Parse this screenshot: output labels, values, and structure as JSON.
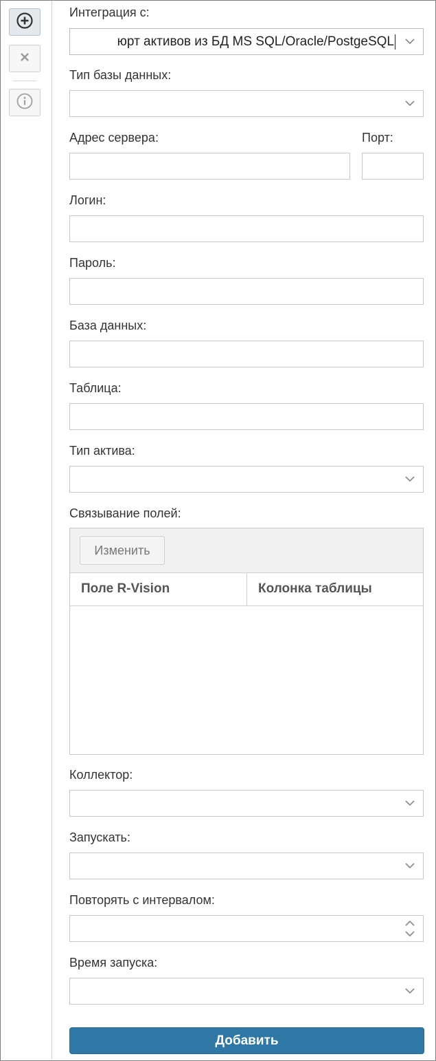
{
  "toolbar": {
    "add_icon": "plus-circle-icon",
    "delete_icon": "close-icon",
    "info_icon": "info-icon"
  },
  "form": {
    "integration_label": "Интеграция с:",
    "integration_value": "юрт активов из БД MS SQL/Oracle/PostgeSQL",
    "db_type_label": "Тип базы данных:",
    "db_type_value": "",
    "server_label": "Адрес сервера:",
    "server_value": "",
    "port_label": "Порт:",
    "port_value": "",
    "login_label": "Логин:",
    "login_value": "",
    "password_label": "Пароль:",
    "password_value": "",
    "database_label": "База данных:",
    "database_value": "",
    "table_label": "Таблица:",
    "table_value": "",
    "asset_type_label": "Тип актива:",
    "asset_type_value": "",
    "mapping_label": "Связывание полей:",
    "mapping": {
      "edit_button": "Изменить",
      "columns": [
        "Поле R-Vision",
        "Колонка таблицы"
      ],
      "rows": []
    },
    "collector_label": "Коллектор:",
    "collector_value": "",
    "run_label": "Запускать:",
    "run_value": "",
    "interval_label": "Повторять с интервалом:",
    "interval_value": "",
    "start_time_label": "Время запуска:",
    "start_time_value": "",
    "submit_label": "Добавить"
  },
  "colors": {
    "primary_button": "#2f77a5",
    "border": "#c8c8c8"
  }
}
